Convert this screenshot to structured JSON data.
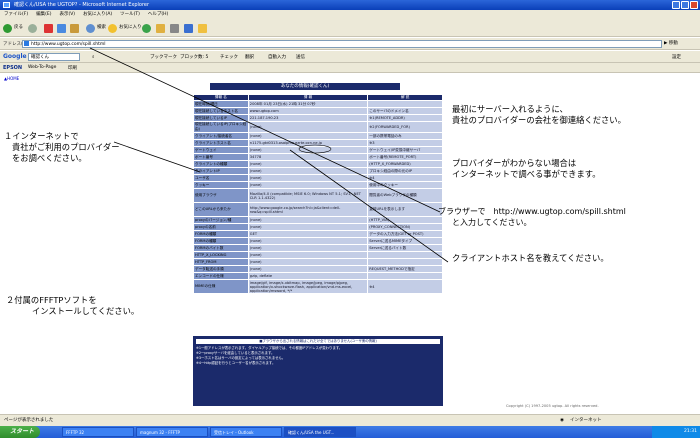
{
  "window": {
    "title": "確認くん/USA the UGTOP? - Microsoft Internet Explorer"
  },
  "menu": [
    "ファイル(F)",
    "編集(E)",
    "表示(V)",
    "お気に入り(A)",
    "ツール(T)",
    "ヘルプ(H)"
  ],
  "toolbar": {
    "back": "戻る",
    "search": "検索",
    "favorites": "お気に入り"
  },
  "address": {
    "label": "アドレス(D)",
    "url": "http://www.ugtop.com/spill.shtml",
    "go": "移動"
  },
  "googlebar": {
    "label": "Google",
    "search_value": "確認くん",
    "bookmark": "ブックマーク",
    "blocked": "ブロック数: 5",
    "check": "チェック",
    "translate": "翻訳",
    "autofill": "自動入力",
    "send": "送信",
    "settings": "設定"
  },
  "epsonbar": {
    "brand": "EPSON",
    "webpage": "Web-To-Page",
    "print": "印刷"
  },
  "page": {
    "home_link": "▲HOME",
    "title": "あなたの情報(確認くん)",
    "table_headers": [
      "情報 名",
      "情 報",
      "解 説"
    ],
    "rows": [
      [
        "現在時刻/曜日",
        "2008年 01月 23日(水) 21時 31分 07秒",
        ""
      ],
      [
        "現在接続しているホスト名",
        "www.ugtop.com",
        "このサーバのドメイン名"
      ],
      [
        "現在接続しているIP",
        "221.187.190.23",
        "※1(REMOTE_ADDR)"
      ],
      [
        "現在接続しているIP(プロキシ経由)",
        "(none)",
        "※2(FORWARDED_FOR)"
      ],
      [
        "クライアント/接続者名",
        "(none)",
        "一部の携帯電話のみ"
      ],
      [
        "クライアントホスト名",
        "n1175-gtd0313.osaipma.ezrte.ocn.ne.jp",
        "※3"
      ],
      [
        "ゲートウェイ",
        "(none)",
        "ゲートウェイ/IP変換中継サーバ"
      ],
      [
        "ポート番号",
        "34778",
        "ポート番号(REMOTE_PORT)"
      ],
      [
        "クライアントの種類",
        "(none)",
        "(HTTP_X_FORWARDED)"
      ],
      [
        "クライアントIP",
        "(none)",
        "プロキシ経由の際の元のIP"
      ],
      [
        "ユーザ名",
        "(none)",
        "※4"
      ],
      [
        "クッキー",
        "(none)",
        "使用中のクッキー"
      ],
      [
        "使用ブラウザ",
        "Mozilla/4.0 (compatible; MSIE 6.0; Windows NT 5.1; SV1; .NET CLR 1.1.4322)",
        "閲覧者のWebブラウザの種類"
      ],
      [
        "どこのURLから来たか",
        "http://www.google.co.jp/search?hl=ja&client=dell-row&q=spill.shtml",
        "直前URLを表示します"
      ],
      [
        "proxyのバージョン/種",
        "(none)",
        "(HTTP_VIA)"
      ],
      [
        "proxyの名前",
        "(none)",
        "(PROXY_CONNECTION)"
      ],
      [
        "FORMの種類",
        "GET",
        "データの入力方法(GET or POST)"
      ],
      [
        "FORMの種類",
        "(none)",
        "Serverに送るMIMEタイプ"
      ],
      [
        "FORMのバイト数",
        "(none)",
        "Serverに送るバイト数"
      ],
      [
        "HTTP_X_LOCKING",
        "(none)",
        ""
      ],
      [
        "HTTP_FROM",
        "(none)",
        ""
      ],
      [
        "データ転送の手順",
        "(none)",
        "REQUEST_METHODで指定"
      ],
      [
        "エンコードの仕様",
        "gzip, deflate",
        ""
      ],
      [
        "MIMEの仕様",
        "image/gif, image/x-xbitmap, image/jpeg, image/pjpeg, application/x-shockwave-flash, application/vnd.ms-excel, application/msword, */*",
        "※4"
      ]
    ],
    "notice_head": "■ブラウザから出される情報はこれだけ全てではありません(ユーザ側の情報)",
    "notice_lines": [
      "※1一般アドレスが表示されます。ダイヤルアップ接続では、その都度IPアドレスが変わります。",
      "※2一proxyサーバを経由していると表示されます。",
      "※3一ホスト名はサーバの設定によっては表示されません。",
      "※4一http認証を行うとユーザー名が表示されます。"
    ],
    "copyright": "Copyright (C) 1997-2005 ugtop. All rights reserved."
  },
  "status": {
    "left": "ページが表示されました",
    "right": "インターネット"
  },
  "taskbar": {
    "start": "スタート",
    "tasks": [
      "FFFTP 32",
      "magnum 32 - FFFTP",
      "受信トレイ - Outlook",
      "確認くん/USA the UGT..."
    ],
    "clock": "21:31"
  },
  "annotations": {
    "a1_line1": "１インターネットで",
    "a1_line2": "貴社がご利用のプロバイダー",
    "a1_line3": "をお調べください。",
    "a2_line1": "２付属のFFFTPソフトを",
    "a2_line2": "インストールしてください。",
    "r1_line1": "最初にサーバー入れるように、",
    "r1_line2": "貴社のプロバイダーの会社を御連絡ください。",
    "r2_line1": "プロバイダーがわからない場合は",
    "r2_line2": "インターネットで調べる事ができます。",
    "r3_line1": "ブラウザーで　http://www.ugtop.com/spill.shtml",
    "r3_line2": "と入力してください。",
    "r4": "クライアントホスト名を教えてください。"
  }
}
